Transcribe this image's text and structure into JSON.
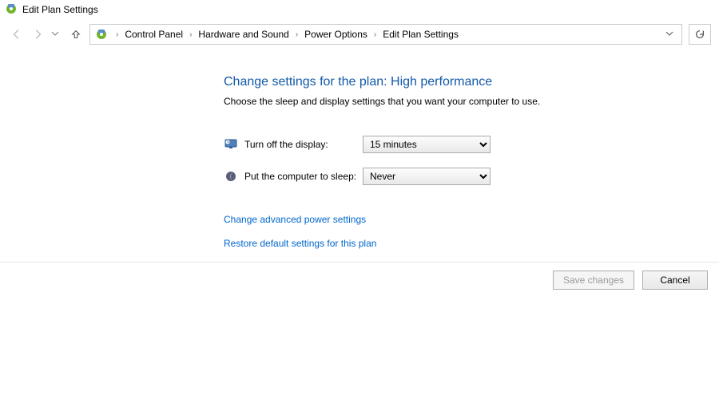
{
  "window": {
    "title": "Edit Plan Settings"
  },
  "breadcrumb": {
    "items": [
      {
        "label": "Control Panel"
      },
      {
        "label": "Hardware and Sound"
      },
      {
        "label": "Power Options"
      },
      {
        "label": "Edit Plan Settings"
      }
    ]
  },
  "page": {
    "heading": "Change settings for the plan: High performance",
    "description": "Choose the sleep and display settings that you want your computer to use."
  },
  "settings": {
    "display_off": {
      "label": "Turn off the display:",
      "value": "15 minutes"
    },
    "sleep": {
      "label": "Put the computer to sleep:",
      "value": "Never"
    }
  },
  "links": {
    "advanced": "Change advanced power settings",
    "restore": "Restore default settings for this plan"
  },
  "footer": {
    "save": "Save changes",
    "cancel": "Cancel"
  }
}
